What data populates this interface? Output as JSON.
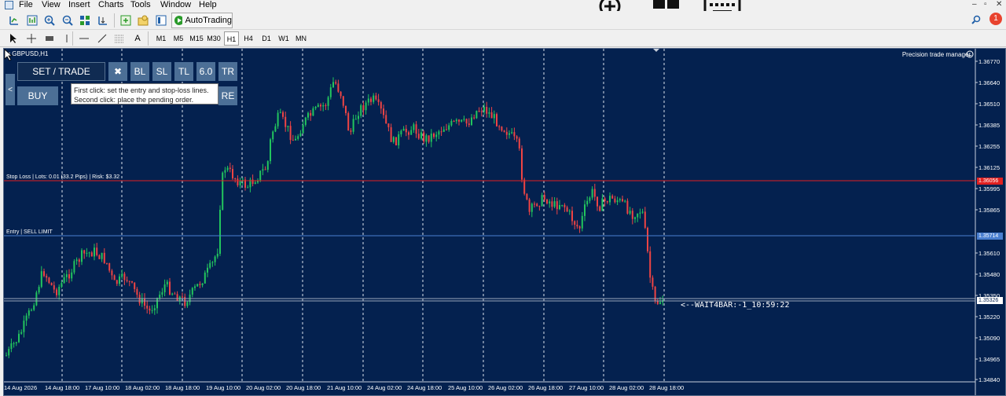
{
  "menu": [
    "File",
    "View",
    "Insert",
    "Charts",
    "Tools",
    "Window",
    "Help"
  ],
  "toolbar": {
    "autotrading_label": "AutoTrading"
  },
  "timeframes": [
    "M1",
    "M5",
    "M15",
    "M30",
    "H1",
    "H4",
    "D1",
    "W1",
    "MN"
  ],
  "active_timeframe": "H1",
  "chart": {
    "symbol": "GBPUSD,H1",
    "indicator_name": "Precision  trade manager",
    "price_ticks": [
      "1.36770",
      "1.36640",
      "1.36510",
      "1.36385",
      "1.36255",
      "1.36125",
      "1.35995",
      "1.35865",
      "1.35610",
      "1.35480",
      "1.35350",
      "1.35220",
      "1.35090",
      "1.34965",
      "1.34840"
    ],
    "time_ticks": [
      "14 Aug 2026",
      "14 Aug 18:00",
      "17 Aug 10:00",
      "18 Aug 02:00",
      "18 Aug 18:00",
      "19 Aug 10:00",
      "20 Aug 02:00",
      "20 Aug 18:00",
      "21 Aug 10:00",
      "24 Aug 02:00",
      "24 Aug 18:00",
      "25 Aug 10:00",
      "26 Aug 02:00",
      "26 Aug 18:00",
      "27 Aug 10:00",
      "28 Aug 02:00",
      "28 Aug 18:00"
    ],
    "stop_loss_label": "Stop Loss | Lots: 0.01 (33.2 Pips) | Risk: $3.32",
    "stop_loss_price": "1.36056",
    "entry_label": "Entry | SELL LIMIT",
    "entry_price": "1.35714",
    "current_price": "1.35326",
    "wait_label": "<--WAIT4BAR:-1_10:59:22",
    "colors": {
      "background": "#04214f",
      "bull": "#22c55e",
      "bear": "#ef4444",
      "stop_loss": "#e02020",
      "entry": "#4a7fd0"
    }
  },
  "panel": {
    "set_trade": "SET / TRADE",
    "close": "✖",
    "bl": "BL",
    "sl": "SL",
    "tl": "TL",
    "lot": "6.0",
    "tr": "TR",
    "buy": "BUY",
    "re": "RE",
    "collapse": "<",
    "tooltip_line1": "First click: set the entry and stop-loss lines.",
    "tooltip_line2": "Second click: place the pending order."
  },
  "notification_count": "1"
}
